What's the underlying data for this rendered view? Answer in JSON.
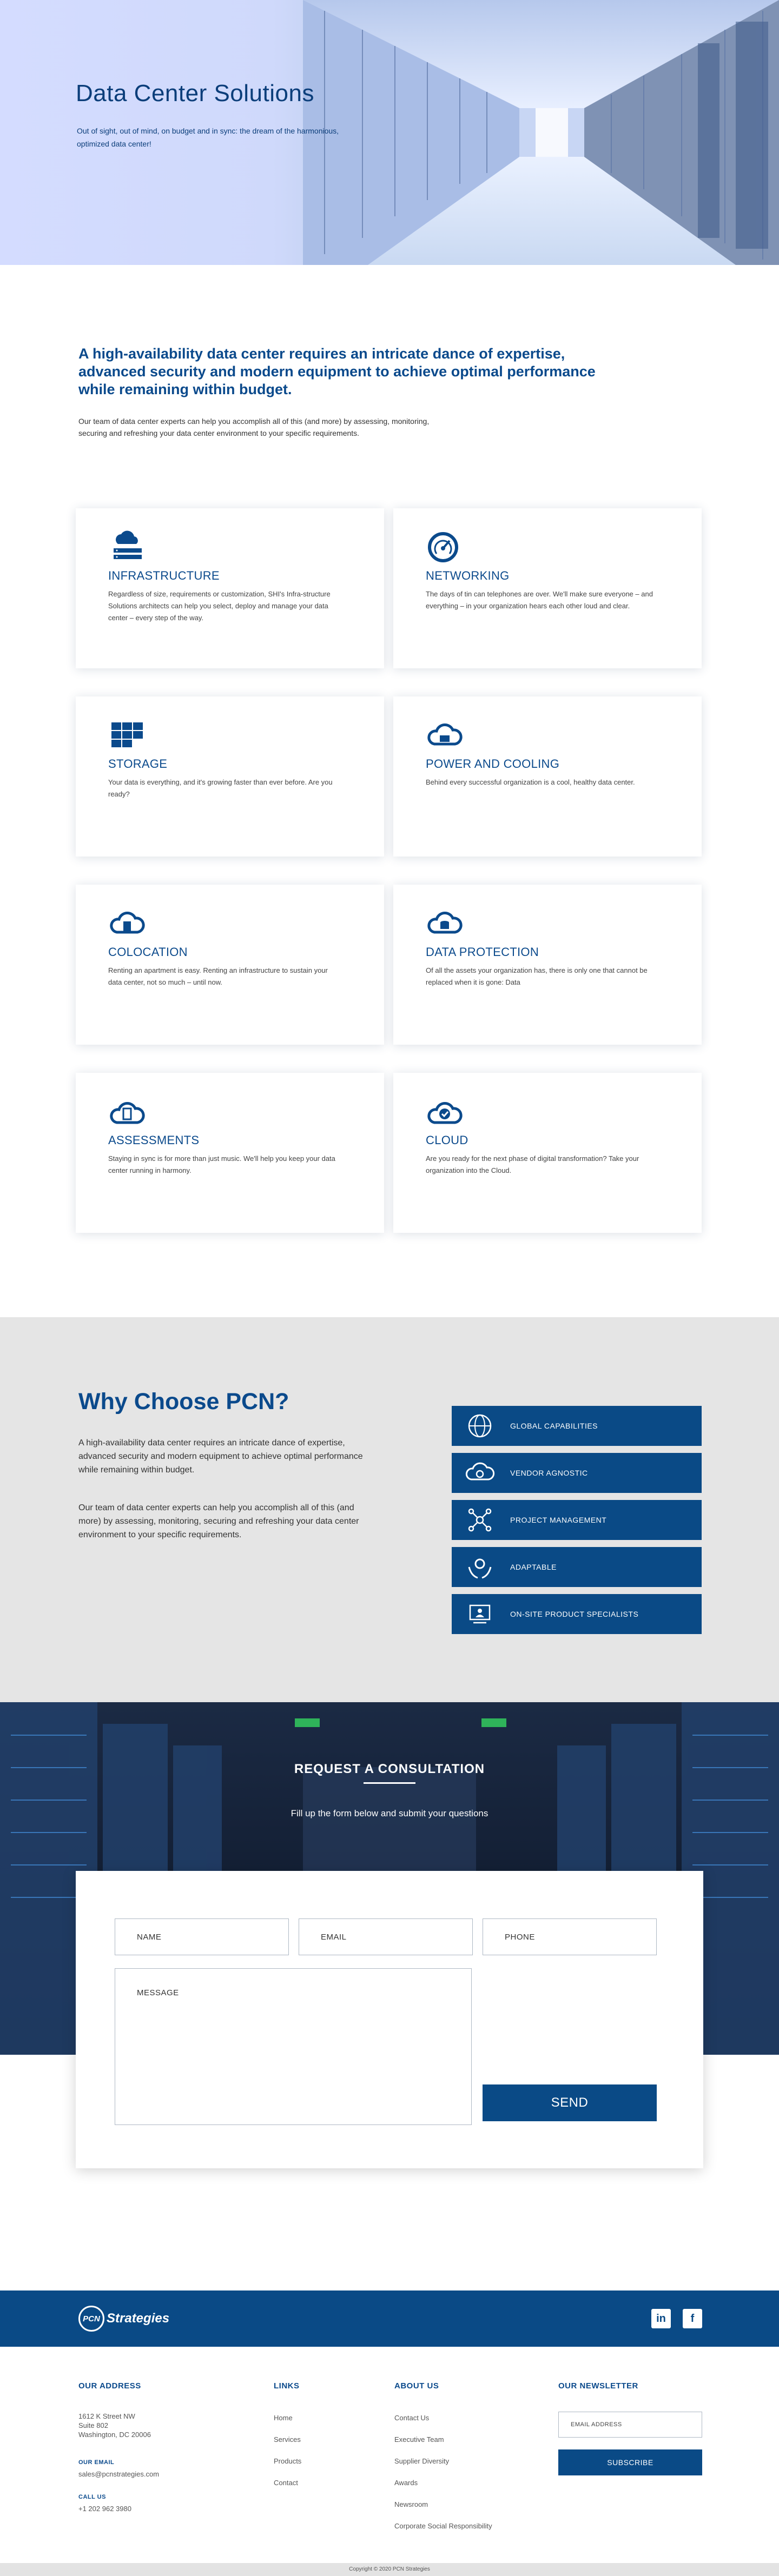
{
  "hero": {
    "title": "Data Center Solutions",
    "subtitle": "Out of sight, out of mind, on budget and in sync: the dream of the harmonious, optimized data center!"
  },
  "intro": {
    "heading": "A high-availability data center requires an intricate dance of expertise, advanced security and modern equipment to achieve optimal performance while remaining within budget.",
    "text": "Our team of data center experts can help you accomplish all of this (and more) by assessing, monitoring, securing and refreshing your data center environment to your specific requirements."
  },
  "services": [
    {
      "title": "INFRASTRUCTURE",
      "text": "Regardless of size, requirements or customization, SHI's Infra-structure Solutions architects can help you select, deploy and manage your data center – every step of the way.",
      "icon": "server-cloud-icon"
    },
    {
      "title": "NETWORKING",
      "text": "The days of tin can telephones are over. We'll make sure everyone – and everything – in your organization hears each other loud and clear.",
      "icon": "speedometer-icon"
    },
    {
      "title": "STORAGE",
      "text": "Your data is everything, and it's growing faster than ever before. Are you ready?",
      "icon": "storage-grid-icon"
    },
    {
      "title": "POWER AND COOLING",
      "text": "Behind every successful organization is a cool, healthy data center.",
      "icon": "cloud-cooling-icon"
    },
    {
      "title": "COLOCATION",
      "text": "Renting an apartment is easy. Renting an infrastructure to sustain your data center, not so much – until now.",
      "icon": "cloud-building-icon"
    },
    {
      "title": "DATA PROTECTION",
      "text": "Of all the assets your organization has, there is only one that cannot be replaced when it is gone: Data",
      "icon": "cloud-database-icon"
    },
    {
      "title": "ASSESSMENTS",
      "text": "Staying in sync is for more than just music. We'll help you keep your data center running in harmony.",
      "icon": "cloud-clipboard-icon"
    },
    {
      "title": "CLOUD",
      "text": "Are you ready for the next phase of digital transformation? Take your organization into the Cloud.",
      "icon": "cloud-check-icon"
    }
  ],
  "why": {
    "title": "Why Choose PCN?",
    "p1": "A high-availability data center requires an intricate dance of expertise, advanced security and modern equipment to achieve optimal performance while remaining within budget.",
    "p2": "Our team of data center experts can help you accomplish all of this (and more) by assessing, monitoring, securing and refreshing your data center environment to your specific requirements.",
    "features": [
      {
        "label": "GLOBAL CAPABILITIES",
        "icon": "globe-icon"
      },
      {
        "label": "VENDOR AGNOSTIC",
        "icon": "cloud-badge-icon"
      },
      {
        "label": "PROJECT MANAGEMENT",
        "icon": "network-nodes-icon"
      },
      {
        "label": "ADAPTABLE",
        "icon": "hands-gear-icon"
      },
      {
        "label": "ON-SITE PRODUCT SPECIALISTS",
        "icon": "monitor-user-icon"
      }
    ]
  },
  "consult": {
    "title": "REQUEST A CONSULTATION",
    "subtitle": "Fill up the form below and submit your questions",
    "name_placeholder": "NAME",
    "email_placeholder": "EMAIL",
    "phone_placeholder": "PHONE",
    "message_placeholder": "MESSAGE",
    "send_label": "SEND"
  },
  "footer": {
    "logo_mark": "PCN",
    "logo_word": "Strategies",
    "address_heading": "OUR ADDRESS",
    "address_lines": [
      "1612 K Street NW",
      "Suite 802",
      "Washington, DC 20006"
    ],
    "email_heading": "OUR EMAIL",
    "email": "sales@pcnstrategies.com",
    "call_heading": "CALL US",
    "phone": "+1 202 962 3980",
    "links_heading": "LINKS",
    "links": [
      "Home",
      "Services",
      "Products",
      "Contact"
    ],
    "about_heading": "ABOUT US",
    "about_links": [
      "Contact Us",
      "Executive Team",
      "Supplier Diversity",
      "Awards",
      "Newsroom",
      "Corporate Social Responsibility"
    ],
    "newsletter_heading": "OUR NEWSLETTER",
    "newsletter_placeholder": "EMAIL ADDRESS",
    "subscribe_label": "SUBSCRIBE",
    "linkedin_label": "in",
    "facebook_label": "f",
    "copyright": "Copyright © 2020 PCN Strategies"
  }
}
